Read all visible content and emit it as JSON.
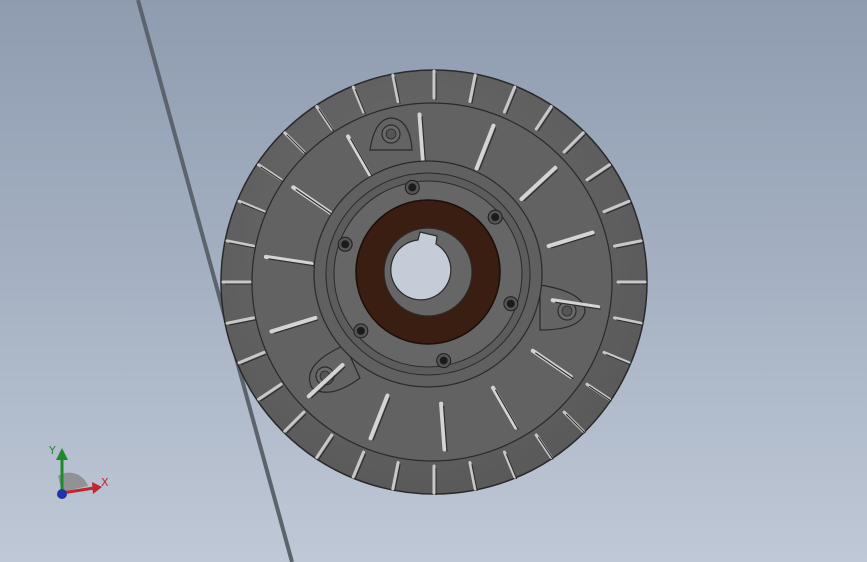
{
  "viewport": {
    "background_top": "#8f9cb0",
    "background_bottom": "#bfc8d6"
  },
  "model": {
    "part": "clutch-brake-disc",
    "body_color": "#646464",
    "edge_color": "#2a2a2a",
    "friction_ring_color": "#3a1e12",
    "bore_color": "#c4ccd8",
    "outer_fins": 32,
    "face_ribs": 14,
    "hub_bolts": 6,
    "mounting_lugs": 3
  },
  "triad": {
    "x_label": "X",
    "y_label": "Y",
    "x_color": "#c0262e",
    "y_color": "#1f8a2a",
    "z_color": "#2233aa"
  },
  "icons": [
    "coordinate-triad-icon"
  ]
}
